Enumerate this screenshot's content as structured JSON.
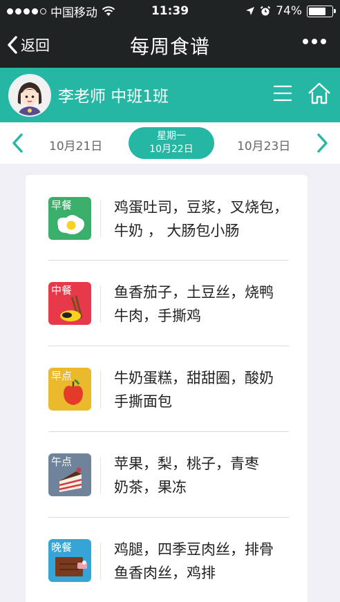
{
  "status": {
    "carrier": "中国移动",
    "time": "11:39",
    "battery": "74%",
    "battery_level": 0.74
  },
  "nav": {
    "back_label": "返回",
    "title": "每周食谱"
  },
  "user": {
    "name": "李老师  中班1班"
  },
  "dates": {
    "prev": "10月21日",
    "current_weekday": "星期一",
    "current_date": "10月22日",
    "next": "10月23日"
  },
  "meals": [
    {
      "tag": "早餐",
      "text": "鸡蛋吐司，豆浆，叉烧包，牛奶 ， 大肠包小肠",
      "color": "#3aae6b",
      "icon": "fried-egg-icon"
    },
    {
      "tag": "中餐",
      "text": "鱼香茄子，土豆丝，烧鸭牛肉，手撕鸡",
      "color": "#e8394b",
      "icon": "rice-bowl-chopsticks-icon"
    },
    {
      "tag": "早点",
      "text": "牛奶蛋糕，甜甜圈，酸奶手撕面包",
      "color": "#eab92c",
      "icon": "apple-icon"
    },
    {
      "tag": "午点",
      "text": "苹果，梨，桃子，青枣奶茶，果冻",
      "color": "#6f849b",
      "icon": "cake-slice-icon"
    },
    {
      "tag": "晚餐",
      "text": "鸡腿，四季豆肉丝，排骨鱼香肉丝，鸡排",
      "color": "#36a4d6",
      "icon": "steak-icon"
    }
  ],
  "colors": {
    "accent": "#26b6a4",
    "dark_bar": "#1f2324"
  }
}
